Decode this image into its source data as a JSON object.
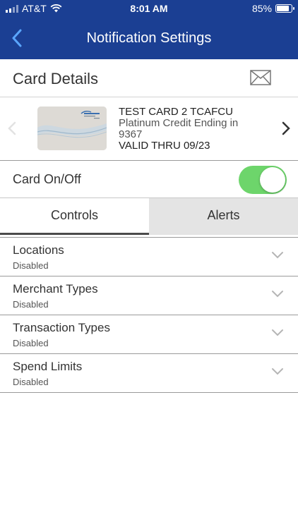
{
  "status_bar": {
    "carrier": "AT&T",
    "time": "8:01 AM",
    "battery_percent": "85%",
    "battery_level": 0.85,
    "icons": [
      "signal-icon",
      "wifi-icon",
      "battery-icon"
    ]
  },
  "nav": {
    "title": "Notification Settings",
    "back_icon": "chevron-left-icon"
  },
  "card_details": {
    "heading": "Card Details",
    "mail_icon": "envelope-icon"
  },
  "card": {
    "name": "TEST CARD 2 TCAFCU",
    "type_line": "Platinum Credit Ending in",
    "last4": "9367",
    "valid_thru": "VALID THRU 09/23"
  },
  "card_toggle": {
    "label": "Card On/Off",
    "state": "on"
  },
  "tabs": [
    {
      "label": "Controls",
      "active": true
    },
    {
      "label": "Alerts",
      "active": false
    }
  ],
  "controls": [
    {
      "title": "Locations",
      "status": "Disabled"
    },
    {
      "title": "Merchant Types",
      "status": "Disabled"
    },
    {
      "title": "Transaction Types",
      "status": "Disabled"
    },
    {
      "title": "Spend Limits",
      "status": "Disabled"
    }
  ],
  "colors": {
    "header_blue": "#1b3f93",
    "toggle_green": "#6dd56b",
    "inactive_tab": "#e4e4e4"
  }
}
